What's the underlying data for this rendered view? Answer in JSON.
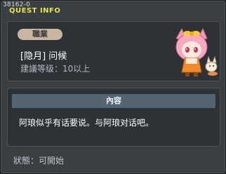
{
  "header": {
    "quest_id": "38162-0",
    "title": "QUEST INFO"
  },
  "quest": {
    "job_label": "職業",
    "name": "[隐月] 问候",
    "level_requirement": "建議等级：10以上",
    "npc_icon": "fox-girl-npc-portrait"
  },
  "content": {
    "header_label": "內容",
    "text": "阿琅似乎有话要说。与阿琅对话吧。"
  },
  "status": {
    "label": "狀態：",
    "value": "可開始"
  },
  "colors": {
    "title": "#e8e24a",
    "badge": "#c8b6a0",
    "content_header": "#546471"
  }
}
